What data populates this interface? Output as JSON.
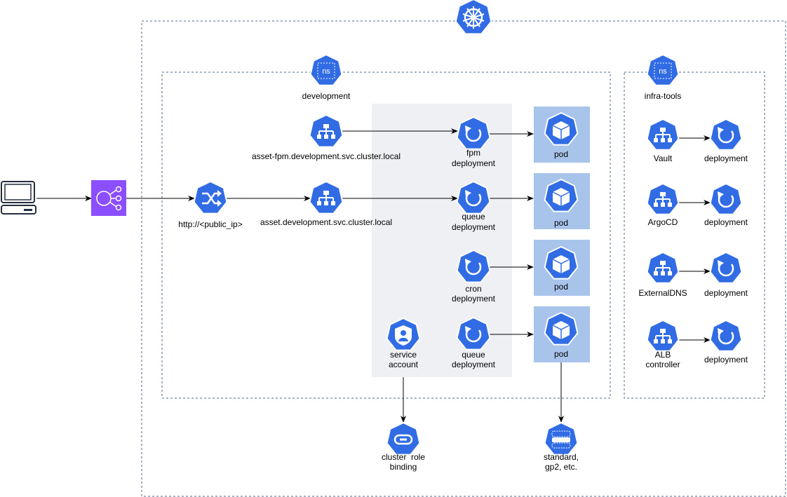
{
  "colors": {
    "kubernetes_blue": "#326ce5",
    "pod_box": "#a9c4eb",
    "group_background": "#eff0f3",
    "load_balancer": "#8c4fff"
  },
  "cluster": {
    "icon": "kubernetes-helm-wheel-icon"
  },
  "client": {
    "icon": "laptop-icon"
  },
  "load_balancer": {
    "icon": "elastic-load-balancer-icon"
  },
  "ingress": {
    "label": "http://<public_ip>"
  },
  "development": {
    "ns_badge": "ns",
    "label": "development",
    "services": [
      {
        "label": "asset-fpm.development.svc.cluster.local"
      },
      {
        "label": "asset.development.svc.cluster.local"
      }
    ],
    "deployments": [
      {
        "line1": "fpm",
        "line2": "deployment"
      },
      {
        "line1": "queue",
        "line2": "deployment"
      },
      {
        "line1": "cron",
        "line2": "deployment"
      },
      {
        "line1": "queue",
        "line2": "deployment"
      }
    ],
    "pods": [
      {
        "label": "pod"
      },
      {
        "label": "pod"
      },
      {
        "label": "pod"
      },
      {
        "label": "pod"
      }
    ],
    "service_account": {
      "line1": "service",
      "line2": "account"
    }
  },
  "cluster_role_binding": {
    "line1": "cluster  role",
    "line2": "binding"
  },
  "storage_class": {
    "line1": "standard,",
    "line2": "gp2, etc."
  },
  "infra_tools": {
    "ns_badge": "ns",
    "label": "infra-tools",
    "rows": [
      {
        "service": "Vault",
        "service2": "",
        "deployment": "deployment"
      },
      {
        "service": "ArgoCD",
        "service2": "",
        "deployment": "deployment"
      },
      {
        "service": "ExternalDNS",
        "service2": "",
        "deployment": "deployment"
      },
      {
        "service": "ALB",
        "service2": "controller",
        "deployment": "deployment"
      }
    ]
  }
}
